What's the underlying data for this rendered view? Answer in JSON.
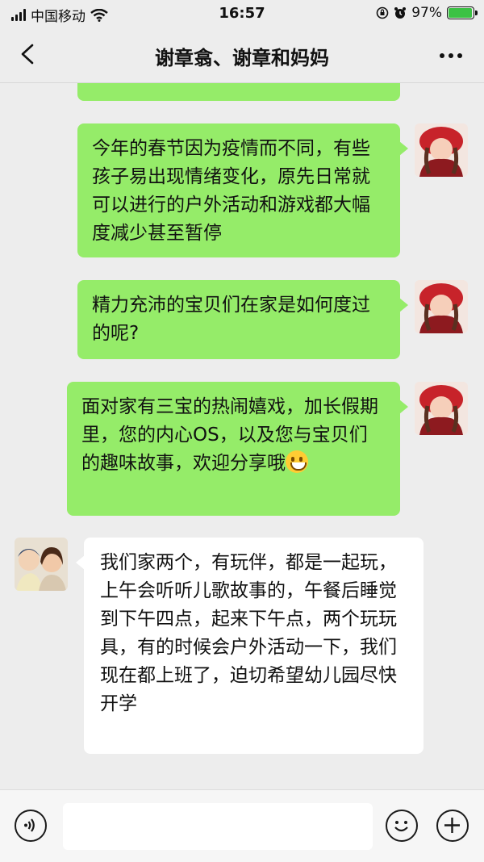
{
  "status_bar": {
    "carrier": "中国移动",
    "time": "16:57",
    "battery_percent": "97%",
    "battery_level": 0.97
  },
  "header": {
    "back_icon": "chevron-left-icon",
    "title": "谢章翕、谢章和妈妈",
    "more_icon": "ellipsis-icon"
  },
  "messages": [
    {
      "direction": "sent",
      "text": "今年的春节因为疫情而不同，有些孩子易出现情绪变化，原先日常就可以进行的户外活动和游戏都大幅度减少甚至暂停"
    },
    {
      "direction": "sent",
      "text": "精力充沛的宝贝们在家是如何度过的呢?"
    },
    {
      "direction": "sent",
      "text": "面对家有三宝的热闹嬉戏，加长假期里，您的内心OS，以及您与宝贝们的趣味故事，欢迎分享哦",
      "emoji": "grinning-face"
    },
    {
      "direction": "received",
      "text": "我们家两个，有玩伴，都是一起玩，上午会听听儿歌故事的，午餐后睡觉到下午四点，起来下午点，两个玩玩具，有的时候会户外活动一下，我们现在都上班了，迫切希望幼儿园尽快开学"
    }
  ],
  "input_bar": {
    "voice_icon": "voice-icon",
    "emoji_icon": "emoji-icon",
    "add_icon": "plus-icon",
    "input_value": ""
  },
  "colors": {
    "sent_bubble": "#95ec69",
    "received_bubble": "#ffffff",
    "background": "#ededed"
  }
}
